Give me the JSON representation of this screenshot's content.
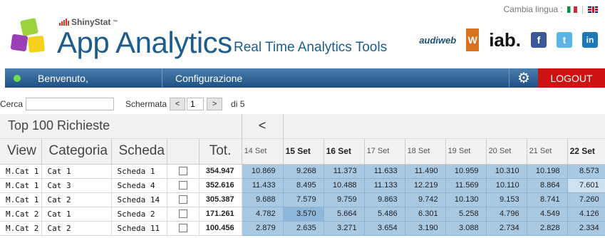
{
  "header": {
    "lang_label": "Cambia lingua :",
    "brand_small": "ShinyStat",
    "brand_sup": "™",
    "title": "App Analytics",
    "subtitle": "Real Time Analytics Tools",
    "partners": {
      "audiweb": "audiweb",
      "w": "W",
      "iab": "iab."
    },
    "social": {
      "fb": "f",
      "tw": "t",
      "li": "in"
    }
  },
  "nav": {
    "welcome": "Benvenuto,",
    "config": "Configurazione",
    "logout": "LOGOUT",
    "colors": {
      "bar": "#2a5d8f",
      "logout": "#cc1212",
      "status": "#6ee04b"
    }
  },
  "search": {
    "label": "Cerca",
    "placeholder": "",
    "screen_label": "Schermata",
    "prev": "<",
    "page": "1",
    "next": ">",
    "of_label": "di 5"
  },
  "grid": {
    "title": "Top 100 Richieste",
    "back": "<",
    "columns": {
      "view": "View",
      "category": "Categoria",
      "screen": "Scheda",
      "total": "Tot."
    },
    "days": [
      {
        "label": "14 Set",
        "bold": false
      },
      {
        "label": "15 Set",
        "bold": true
      },
      {
        "label": "16 Set",
        "bold": true
      },
      {
        "label": "17 Set",
        "bold": false
      },
      {
        "label": "18 Set",
        "bold": false
      },
      {
        "label": "19 Set",
        "bold": false
      },
      {
        "label": "20 Set",
        "bold": false
      },
      {
        "label": "21 Set",
        "bold": false
      },
      {
        "label": "22 Set",
        "bold": true
      }
    ],
    "rows": [
      {
        "view": "M.Cat 1",
        "category": "Cat 1",
        "screen": "Scheda 1",
        "total": "354.947",
        "values": [
          "10.869",
          "9.268",
          "11.373",
          "11.633",
          "11.490",
          "10.959",
          "10.310",
          "10.198",
          "8.573"
        ]
      },
      {
        "view": "M.Cat 1",
        "category": "Cat 3",
        "screen": "Scheda 4",
        "total": "352.616",
        "values": [
          "11.433",
          "8.495",
          "10.488",
          "11.133",
          "12.219",
          "11.569",
          "10.110",
          "8.864",
          "7.601"
        ]
      },
      {
        "view": "M.Cat 1",
        "category": "Cat 2",
        "screen": "Scheda 14",
        "total": "305.387",
        "values": [
          "9.688",
          "7.579",
          "9.759",
          "9.863",
          "9.742",
          "10.130",
          "9.153",
          "8.741",
          "7.260"
        ]
      },
      {
        "view": "M.Cat 2",
        "category": "Cat 1",
        "screen": "Scheda 2",
        "total": "171.261",
        "values": [
          "4.782",
          "3.570",
          "5.664",
          "5.486",
          "6.301",
          "5.258",
          "4.796",
          "4.549",
          "4.126"
        ]
      },
      {
        "view": "M.Cat 2",
        "category": "Cat 2",
        "screen": "Scheda 11",
        "total": "100.456",
        "values": [
          "2.879",
          "2.635",
          "3.271",
          "3.654",
          "3.190",
          "3.088",
          "2.734",
          "2.828",
          "2.334"
        ]
      }
    ]
  }
}
